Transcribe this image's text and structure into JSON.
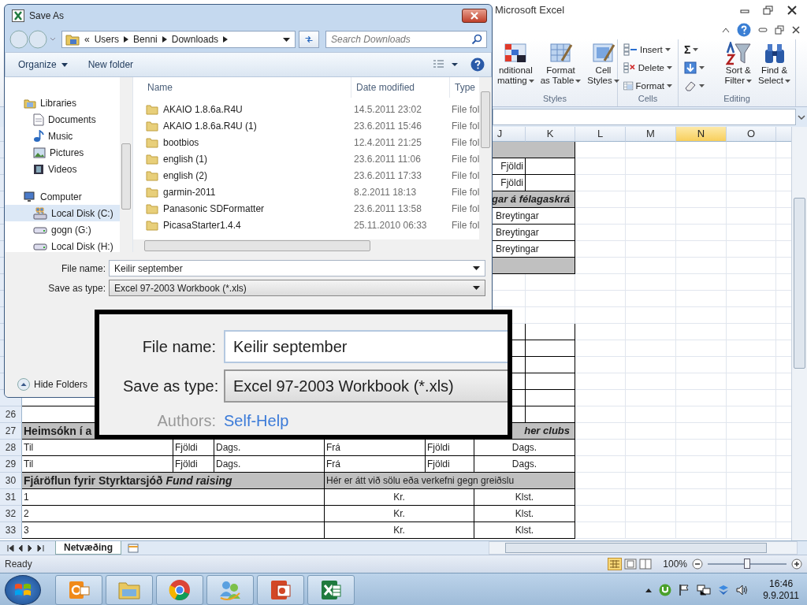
{
  "excel": {
    "title": "Microsoft Excel",
    "ribbon": {
      "styles": {
        "label": "Styles",
        "commands": [
          {
            "lines": [
              "nditional",
              "matting"
            ],
            "dropdown": true
          },
          {
            "lines": [
              "Format",
              "as Table"
            ],
            "dropdown": true
          },
          {
            "lines": [
              "Cell",
              "Styles"
            ],
            "dropdown": true
          }
        ]
      },
      "cells": {
        "label": "Cells",
        "commands": [
          {
            "label": "Insert",
            "kind": "insert"
          },
          {
            "label": "Delete",
            "kind": "delete"
          },
          {
            "label": "Format",
            "kind": "format"
          }
        ]
      },
      "editing": {
        "label": "Editing",
        "sum_symbol": "Σ",
        "commands": [
          {
            "lines": [
              "Sort &",
              "Filter"
            ],
            "kind": "sort"
          },
          {
            "lines": [
              "Find &",
              "Select"
            ],
            "kind": "find"
          }
        ]
      }
    },
    "column_headers": [
      {
        "label": "J",
        "selected": false
      },
      {
        "label": "K",
        "selected": false
      },
      {
        "label": "L",
        "selected": false
      },
      {
        "label": "M",
        "selected": false
      },
      {
        "label": "N",
        "selected": true
      },
      {
        "label": "O",
        "selected": false
      }
    ],
    "rows": [
      {
        "kind": "title"
      },
      {
        "kind": "count",
        "text": "Fjöldi"
      },
      {
        "kind": "count",
        "text": "Fjöldi"
      },
      {
        "kind": "title",
        "right": "gar á félagaskrá"
      },
      {
        "kind": "change",
        "text": "Breytingar"
      },
      {
        "kind": "change",
        "text": "Breytingar"
      },
      {
        "kind": "change",
        "text": "Breytingar"
      },
      {
        "kind": "title"
      },
      {
        "kind": "plain"
      },
      {
        "kind": "plain"
      },
      {
        "kind": "plain"
      },
      {
        "kind": "blank"
      },
      {
        "kind": "blank"
      },
      {
        "kind": "blank"
      },
      {
        "kind": "blank"
      },
      {
        "kind": "blank"
      },
      {
        "kind": "blank",
        "number": "26"
      },
      {
        "kind": "title",
        "number": "27",
        "left": "Heimsókn í a",
        "right": "her clubs"
      },
      {
        "kind": "pair",
        "number": "28",
        "cells": [
          "Til",
          "Fjöldi",
          "Dags.",
          "Frá",
          "Fjöldi",
          "Dags."
        ]
      },
      {
        "kind": "pair",
        "number": "29",
        "cells": [
          "Til",
          "Fjöldi",
          "Dags.",
          "Frá",
          "Fjöldi",
          "Dags."
        ]
      },
      {
        "kind": "section",
        "number": "30",
        "left": "Fjáröflun fyrir Styrktarsjóð *Fund raising*",
        "right": "Hér er átt við sölu eða verkefni gegn greiðslu"
      },
      {
        "kind": "fund",
        "number": "31",
        "cells": [
          "1",
          "Kr.",
          "Klst."
        ]
      },
      {
        "kind": "fund",
        "number": "32",
        "cells": [
          "2",
          "Kr.",
          "Klst."
        ]
      },
      {
        "kind": "fund",
        "number": "33",
        "cells": [
          "3",
          "Kr.",
          "Klst."
        ]
      }
    ],
    "sheet_tabs": [
      {
        "label": "Netvæðing",
        "selected": true
      }
    ],
    "status": {
      "text": "Ready",
      "zoom": "100%",
      "level": 0.5
    }
  },
  "save_dialog": {
    "title": "Save As",
    "breadcrumb": [
      "«",
      "Users",
      "Benni",
      "Downloads"
    ],
    "search": {
      "placeholder": "Search Downloads"
    },
    "toolbar": [
      {
        "label": "Organize",
        "dropdown": true
      },
      {
        "label": "New folder",
        "dropdown": false
      }
    ],
    "nav": [
      {
        "label": "Libraries",
        "selected": false,
        "children": [
          {
            "label": "Documents",
            "selected": false
          },
          {
            "label": "Music",
            "selected": false
          },
          {
            "label": "Pictures",
            "selected": false
          },
          {
            "label": "Videos",
            "selected": false
          }
        ]
      },
      {
        "label": "Computer",
        "selected": false,
        "children": [
          {
            "label": "Local Disk (C:)",
            "selected": true
          },
          {
            "label": "gogn (G:)",
            "selected": false
          },
          {
            "label": "Local Disk (H:)",
            "selected": false
          }
        ]
      }
    ],
    "columns": [
      "Name",
      "Date modified",
      "Type"
    ],
    "files": [
      {
        "name": "AKAIO 1.8.6a.R4U",
        "date": "14.5.2011 23:02",
        "type": "File fol"
      },
      {
        "name": "AKAIO 1.8.6a.R4U (1)",
        "date": "23.6.2011 15:46",
        "type": "File fol"
      },
      {
        "name": "bootbios",
        "date": "12.4.2011 21:25",
        "type": "File fol"
      },
      {
        "name": "english (1)",
        "date": "23.6.2011 11:06",
        "type": "File fol"
      },
      {
        "name": "english (2)",
        "date": "23.6.2011 17:33",
        "type": "File fol"
      },
      {
        "name": "garmin-2011",
        "date": "8.2.2011 18:13",
        "type": "File fol"
      },
      {
        "name": "Panasonic SDFormatter",
        "date": "23.6.2011 13:58",
        "type": "File fol"
      },
      {
        "name": "PicasaStarter1.4.4",
        "date": "25.11.2010 06:33",
        "type": "File fol"
      }
    ],
    "file_name": {
      "label": "File name:",
      "value": "Keilir september"
    },
    "save_type": {
      "label": "Save as type:",
      "value": "Excel 97-2003 Workbook (*.xls)"
    },
    "hide_folders": "Hide Folders"
  },
  "inset": {
    "file_name": {
      "label": "File name:",
      "value": "Keilir september"
    },
    "save_type": {
      "label": "Save as type:",
      "value": "Excel 97-2003 Workbook (*.xls)"
    },
    "authors": {
      "label": "Authors:",
      "value": "Self-Help"
    }
  },
  "taskbar": {
    "apps": [
      {
        "kind": "mail"
      },
      {
        "kind": "folder"
      },
      {
        "kind": "browser"
      },
      {
        "kind": "chat"
      },
      {
        "kind": "slides"
      },
      {
        "kind": "sheet"
      }
    ],
    "time": "16:46",
    "date": "9.9.2011"
  }
}
